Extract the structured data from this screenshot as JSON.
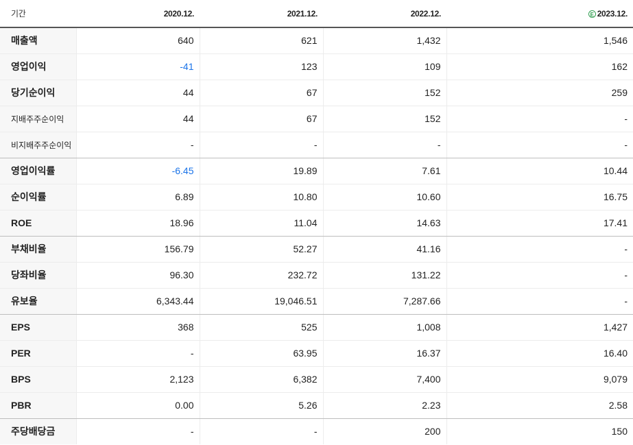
{
  "header": {
    "period_label": "기간",
    "columns": [
      {
        "label": "2020.12.",
        "estimate": false
      },
      {
        "label": "2021.12.",
        "estimate": false
      },
      {
        "label": "2022.12.",
        "estimate": false
      },
      {
        "label": "2023.12.",
        "estimate": true,
        "badge": "E"
      }
    ]
  },
  "colors": {
    "negative": "#1a73e8",
    "estimate_badge": "#2e9d4e",
    "label_background": "#f7f7f7"
  },
  "rows": [
    {
      "label": "매출액",
      "small": false,
      "values": [
        "640",
        "621",
        "1,432",
        "1,546"
      ],
      "negative": [
        false,
        false,
        false,
        false
      ]
    },
    {
      "label": "영업이익",
      "small": false,
      "values": [
        "-41",
        "123",
        "109",
        "162"
      ],
      "negative": [
        true,
        false,
        false,
        false
      ]
    },
    {
      "label": "당기순이익",
      "small": false,
      "values": [
        "44",
        "67",
        "152",
        "259"
      ],
      "negative": [
        false,
        false,
        false,
        false
      ]
    },
    {
      "label": "지배주주순이익",
      "small": true,
      "values": [
        "44",
        "67",
        "152",
        "-"
      ],
      "negative": [
        false,
        false,
        false,
        false
      ]
    },
    {
      "label": "비지배주주순이익",
      "small": true,
      "values": [
        "-",
        "-",
        "-",
        "-"
      ],
      "negative": [
        false,
        false,
        false,
        false
      ],
      "group_end": true
    },
    {
      "label": "영업이익률",
      "small": false,
      "values": [
        "-6.45",
        "19.89",
        "7.61",
        "10.44"
      ],
      "negative": [
        true,
        false,
        false,
        false
      ]
    },
    {
      "label": "순이익률",
      "small": false,
      "values": [
        "6.89",
        "10.80",
        "10.60",
        "16.75"
      ],
      "negative": [
        false,
        false,
        false,
        false
      ]
    },
    {
      "label": "ROE",
      "small": false,
      "values": [
        "18.96",
        "11.04",
        "14.63",
        "17.41"
      ],
      "negative": [
        false,
        false,
        false,
        false
      ],
      "group_end": true
    },
    {
      "label": "부채비율",
      "small": false,
      "values": [
        "156.79",
        "52.27",
        "41.16",
        "-"
      ],
      "negative": [
        false,
        false,
        false,
        false
      ]
    },
    {
      "label": "당좌비율",
      "small": false,
      "values": [
        "96.30",
        "232.72",
        "131.22",
        "-"
      ],
      "negative": [
        false,
        false,
        false,
        false
      ]
    },
    {
      "label": "유보율",
      "small": false,
      "values": [
        "6,343.44",
        "19,046.51",
        "7,287.66",
        "-"
      ],
      "negative": [
        false,
        false,
        false,
        false
      ],
      "group_end": true
    },
    {
      "label": "EPS",
      "small": false,
      "values": [
        "368",
        "525",
        "1,008",
        "1,427"
      ],
      "negative": [
        false,
        false,
        false,
        false
      ]
    },
    {
      "label": "PER",
      "small": false,
      "values": [
        "-",
        "63.95",
        "16.37",
        "16.40"
      ],
      "negative": [
        false,
        false,
        false,
        false
      ]
    },
    {
      "label": "BPS",
      "small": false,
      "values": [
        "2,123",
        "6,382",
        "7,400",
        "9,079"
      ],
      "negative": [
        false,
        false,
        false,
        false
      ]
    },
    {
      "label": "PBR",
      "small": false,
      "values": [
        "0.00",
        "5.26",
        "2.23",
        "2.58"
      ],
      "negative": [
        false,
        false,
        false,
        false
      ],
      "group_end": true
    },
    {
      "label": "주당배당금",
      "small": false,
      "values": [
        "-",
        "-",
        "200",
        "150"
      ],
      "negative": [
        false,
        false,
        false,
        false
      ]
    }
  ]
}
